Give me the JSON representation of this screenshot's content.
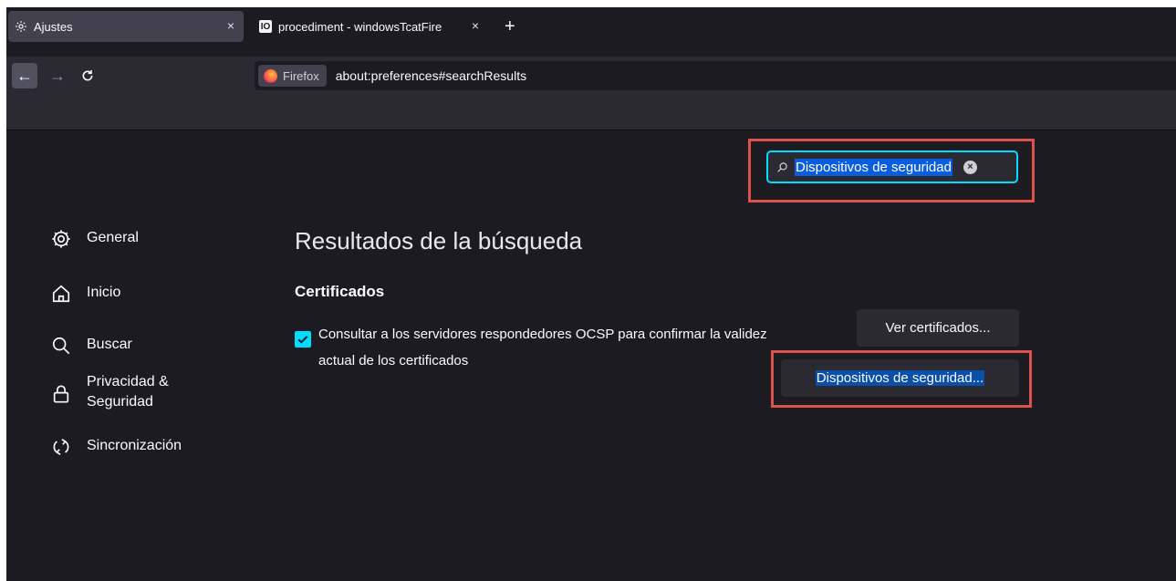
{
  "tabs": [
    {
      "label": "Ajustes",
      "icon": "gear-icon",
      "close": "×"
    },
    {
      "label": "procediment - windowsTcatFire",
      "icon": "site-favicon-icon",
      "favicon_text": "IO",
      "close": "×"
    }
  ],
  "new_tab": "+",
  "nav": {
    "back": "←",
    "forward": "→",
    "reload": "C"
  },
  "urlbar": {
    "identity_label": "Firefox",
    "url": "about:preferences#searchResults"
  },
  "search": {
    "value": "Dispositivos de seguridad",
    "clear": "×"
  },
  "sidebar": {
    "items": [
      {
        "label": "General",
        "icon": "gear-icon"
      },
      {
        "label": "Inicio",
        "icon": "home-icon"
      },
      {
        "label": "Buscar",
        "icon": "search-icon"
      },
      {
        "label": "Privacidad & Seguridad",
        "icon": "lock-icon"
      },
      {
        "label": "Sincronización",
        "icon": "sync-icon"
      }
    ]
  },
  "main": {
    "title": "Resultados de la búsqueda",
    "section_title": "Certificados",
    "ocsp_checkbox": {
      "checked": true,
      "label": "Consultar a los servidores respondedores OCSP para confirmar la validez actual de los certificados"
    },
    "view_certs_button": "Ver certificados...",
    "security_devices_button": "Dispositivos de seguridad..."
  },
  "colors": {
    "accent": "#00ddff",
    "highlight": "#0a5ddc",
    "annotation": "#dc5149",
    "background": "#1c1b22"
  }
}
